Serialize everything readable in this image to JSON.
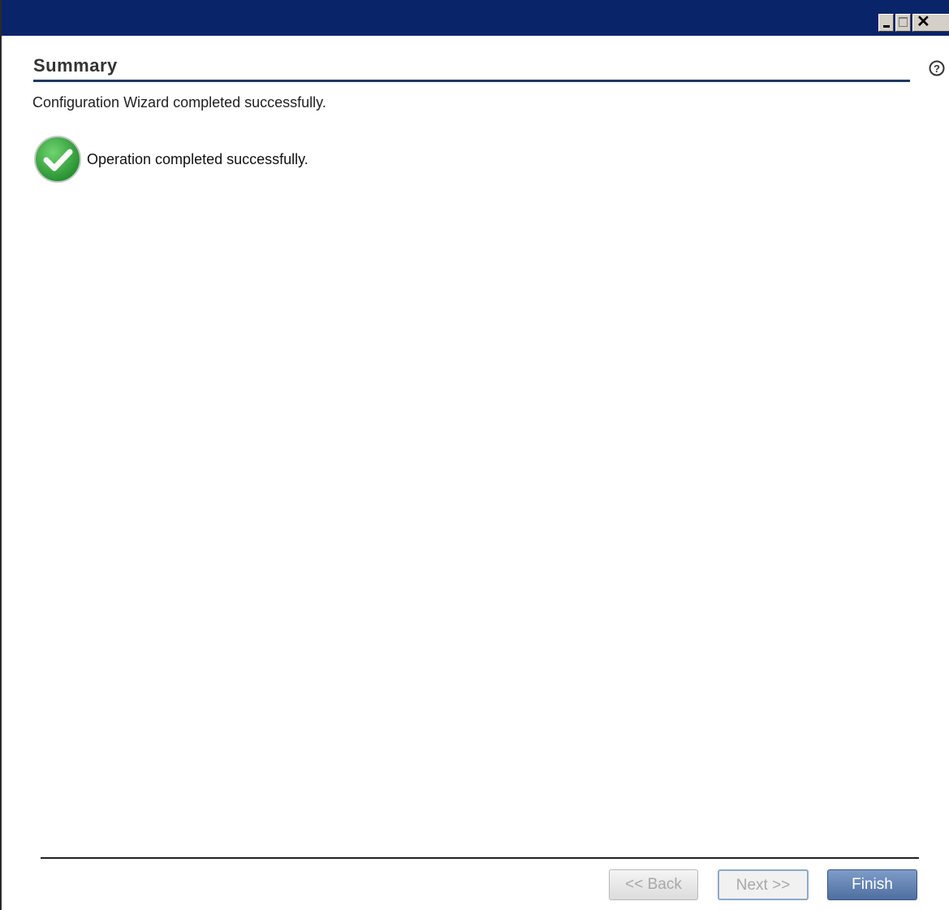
{
  "window": {
    "controls": {
      "minimize_icon": "minimize-icon",
      "maximize_icon": "maximize-icon",
      "close_icon": "close-icon"
    }
  },
  "page": {
    "title": "Summary",
    "subtitle": "Configuration Wizard completed successfully.",
    "help_icon": "help-icon"
  },
  "status": {
    "icon": "success-check-icon",
    "message": "Operation completed successfully."
  },
  "buttons": {
    "back": "<< Back",
    "next": "Next >>",
    "finish": "Finish"
  },
  "colors": {
    "titlebar": "#0a246a",
    "heading_rule": "#1f3a60",
    "success": "#3aa23a",
    "finish_button": "#5b7aa8"
  }
}
